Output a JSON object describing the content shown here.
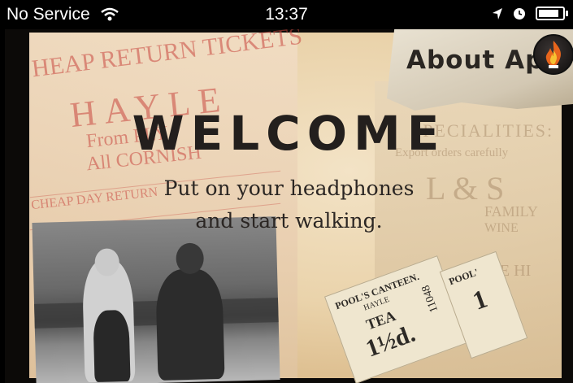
{
  "status_bar": {
    "carrier": "No Service",
    "time": "13:37",
    "battery_level": 0.85
  },
  "about_button": {
    "label": "About App"
  },
  "welcome": {
    "title": "WELCOME",
    "subtitle_line1": "Put on your headphones",
    "subtitle_line2": "and start walking."
  },
  "background_text": {
    "line1": "HEAP RETURN TICKETS",
    "line2": "HAYLE",
    "line3": "From PLY",
    "line4": "All CORNISH",
    "line5": "CHEAP DAY RETURN",
    "line6": "SPECIALITIES:",
    "line7": "Export orders carefully",
    "line8": "L & S",
    "line9": "FAMILY",
    "line10": "WINE",
    "line11": "ROSE HI",
    "ticket1_top": "POOL'S CANTEEN.",
    "ticket1_sub": "HAYLE",
    "ticket1_item": "TEA",
    "ticket1_number": "11048",
    "ticket1_price": "1½d.",
    "ticket2_top": "POOL'",
    "ticket2_price": "1"
  },
  "colors": {
    "paper": "#ead3ab",
    "ink_red": "#c9473f",
    "ink_dark": "#231f1d"
  }
}
